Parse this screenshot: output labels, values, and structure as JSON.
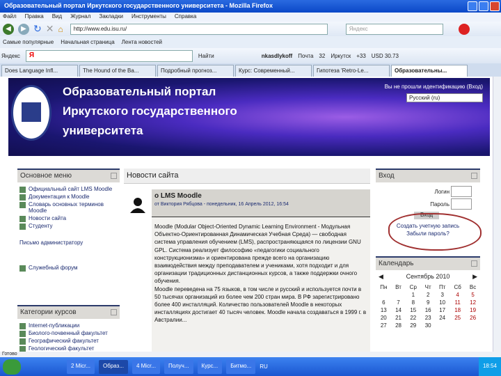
{
  "window": {
    "title": "Образовательный портал Иркутского государственного университета - Mozilla Firefox"
  },
  "menu": [
    "Файл",
    "Правка",
    "Вид",
    "Журнал",
    "Закладки",
    "Инструменты",
    "Справка"
  ],
  "nav": {
    "url": "http://www.edu.isu.ru/",
    "search_placeholder": "Яндекс"
  },
  "bookmarks": [
    "Самые популярные",
    "Начальная страница",
    "Лента новостей"
  ],
  "yandex_bar": {
    "label": "Яндекс",
    "input": "Я",
    "find": "Найти",
    "user": "nkasdlykoff",
    "mail": "Почта",
    "count": "32",
    "weather": "Иркутск",
    "temp": "+33",
    "rate": "USD 30.73"
  },
  "tabs": [
    "Does Language Infl...",
    "The Hound of the Ba...",
    "Подробный прогноз...",
    "Курс: Современный...",
    "Гипотеза 'Retro-Le...",
    "Образовательны..."
  ],
  "banner": {
    "line1": "Образовательный портал",
    "line2": "Иркутского государственного",
    "line3": "университета",
    "auth": "Вы не прошли идентификацию (Вход)",
    "lang": "Русский (ru)"
  },
  "main_menu": {
    "title": "Основное меню",
    "items": [
      "Официальный сайт LMS Moodle",
      "Документация к Moodle",
      "Словарь основных терминов Moodle",
      "Новости сайта",
      "Студенту"
    ],
    "mail": "Письмо администратору",
    "forum": "Служебный форум"
  },
  "categories": {
    "title": "Категории курсов",
    "items": [
      "Internet-публикации",
      "Биолого-почвенный факультет",
      "Географический факультет",
      "Геологический факультет"
    ]
  },
  "news": {
    "title": "Новости сайта",
    "post_title": "о LMS Moodle",
    "post_meta": "от Виктория Рябцова - понедельник, 16 Апрель 2012, 16:54",
    "paragraphs": [
      "Moodle (Modular Object-Oriented Dynamic Learning Environment - Модульная Объектно-Ориентированная Динамическая Учебная Среда) — свободная система управления обучением (LMS), распространяющаяся по лицензии GNU GPL. Система реализует философию «педагогики социального конструкционизма» и ориентирована прежде всего на организацию взаимодействия между преподавателем и учениками, хотя подходит и для организации традиционных дистанционных курсов, а также поддержки очного обучения.",
      "Moodle переведена на 75 языков, в том числе и русский и используется почти в 50 тысячах организаций из более чем 200 стран мира. В РФ зарегистрировано более 400 инсталляций. Количество пользователей Moodle в некоторых инсталляциях достигает 40 тысяч человек. Moodle начала создаваться в 1999 г. в Австралии..."
    ]
  },
  "login": {
    "title": "Вход",
    "login_label": "Логин",
    "password_label": "Пароль",
    "button": "Вход",
    "create": "Создать учетную запись",
    "forgot": "Забыли пароль?"
  },
  "calendar": {
    "title": "Календарь",
    "month": "Сентябрь 2010",
    "days": [
      "Пн",
      "Вт",
      "Ср",
      "Чт",
      "Пт",
      "Сб",
      "Вс"
    ],
    "weeks": [
      [
        "",
        "",
        "1",
        "2",
        "3",
        "4",
        "5"
      ],
      [
        "6",
        "7",
        "8",
        "9",
        "10",
        "11",
        "12"
      ],
      [
        "13",
        "14",
        "15",
        "16",
        "17",
        "18",
        "19"
      ],
      [
        "20",
        "21",
        "22",
        "23",
        "24",
        "25",
        "26"
      ],
      [
        "27",
        "28",
        "29",
        "30",
        "",
        "",
        ""
      ]
    ]
  },
  "status": "Готово",
  "taskbar": {
    "items": [
      "2 Micr...",
      "Образ...",
      "4 Micr...",
      "Получ...",
      "Курс...",
      "Битмо..."
    ],
    "lang": "RU",
    "clock": "18:54"
  },
  "colors": {
    "titlebar": "#0a48c8",
    "banner": "#1a1670",
    "block_border": "#2b3a6a",
    "annotation": "#a03030"
  }
}
